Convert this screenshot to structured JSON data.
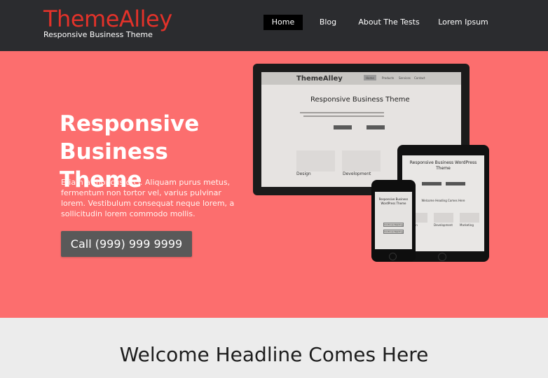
{
  "brand": {
    "logo": "ThemeAlley",
    "tagline": "Responsive Business Theme",
    "accent_color": "#e2322a"
  },
  "nav": {
    "items": [
      {
        "label": "Home",
        "active": true
      },
      {
        "label": "Blog",
        "active": false
      },
      {
        "label": "About The Tests",
        "active": false
      },
      {
        "label": "Lorem Ipsum",
        "active": false
      }
    ]
  },
  "hero": {
    "title": "Responsive Business Theme",
    "text": "Etiam a rhoncus orci. Aliquam purus metus, fermentum non tortor vel, varius pulvinar lorem. Vestibulum consequat neque lorem, a sollicitudin lorem commodo mollis.",
    "call_button": "Call (999) 999 9999",
    "background_color": "#fc6e6e"
  },
  "mockups": {
    "monitor": {
      "logo": "ThemeAlley",
      "nav": [
        "Home",
        "Products",
        "Services",
        "Contact"
      ],
      "title": "Responsive Business Theme",
      "labels": [
        "Design",
        "Development"
      ]
    },
    "tablet": {
      "title": "Responsive Business WordPress Theme",
      "subtitle": "Welcome Heading Comes Here",
      "labels": [
        "Design",
        "Development",
        "Marketing"
      ]
    },
    "phone": {
      "title": "Responsive Business WordPress Theme",
      "buttons": [
        "Continue Reading",
        "Continue Reading"
      ]
    }
  },
  "section": {
    "headline": "Welcome Headline Comes Here"
  }
}
